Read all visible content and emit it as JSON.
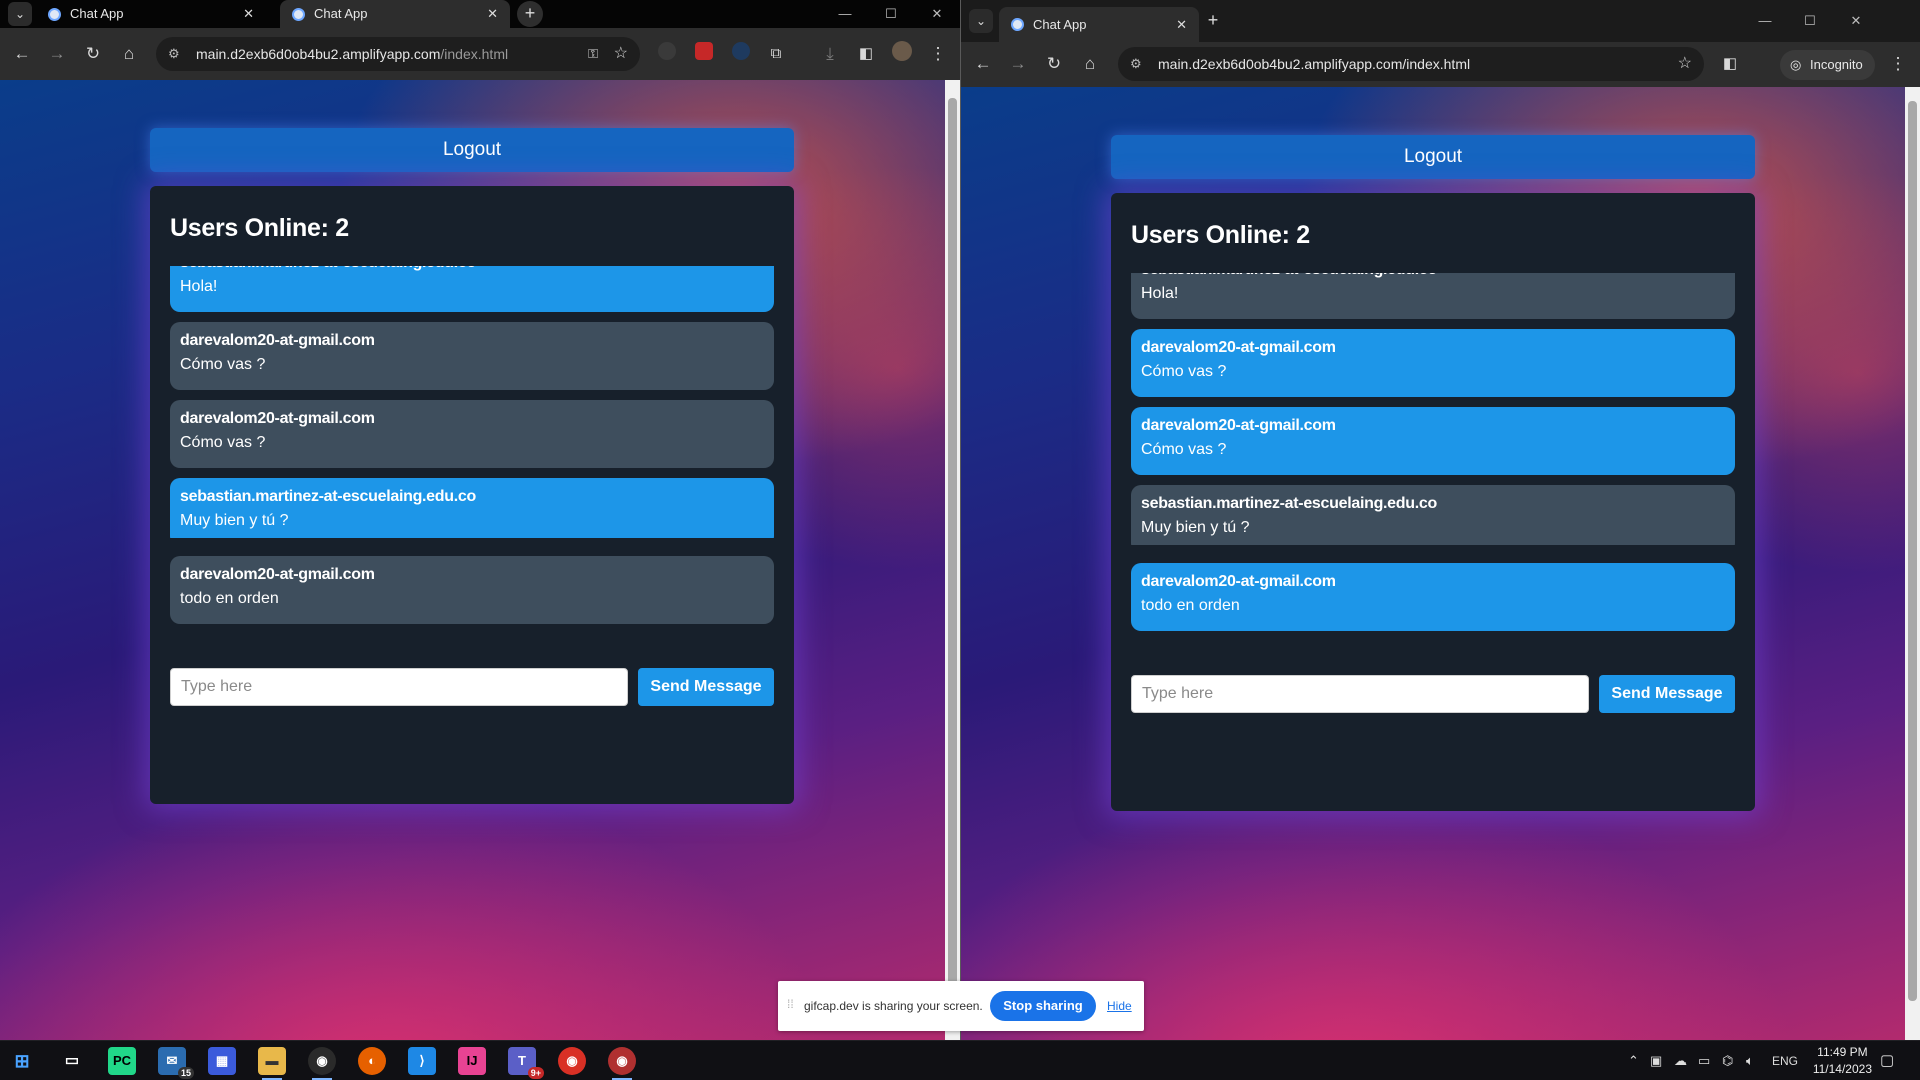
{
  "browser": {
    "tab_title": "Chat App",
    "url_host": "main.d2exb6d0ob4bu2.amplifyapp.com",
    "url_path": "/index.html",
    "incognito_label": "Incognito"
  },
  "app": {
    "logout_label": "Logout",
    "users_online": "Users Online: 2",
    "input_placeholder": "Type here",
    "send_label": "Send Message",
    "messages": [
      {
        "sender": "sebastian.martinez-at-escuelaing.edu.co",
        "text": "Hola!"
      },
      {
        "sender": "darevalom20-at-gmail.com",
        "text": "Cómo vas ?"
      },
      {
        "sender": "darevalom20-at-gmail.com",
        "text": "Cómo vas ?"
      },
      {
        "sender": "sebastian.martinez-at-escuelaing.edu.co",
        "text": "Muy bien y tú ?"
      },
      {
        "sender": "darevalom20-at-gmail.com",
        "text": "todo en orden"
      }
    ]
  },
  "share_banner": {
    "text": "gifcap.dev is sharing your screen.",
    "stop_label": "Stop sharing",
    "hide_label": "Hide"
  },
  "taskbar": {
    "mail_badge": "15",
    "teams_badge": "9+",
    "lang": "ENG",
    "time": "11:49 PM",
    "date": "11/14/2023"
  },
  "colors": {
    "mine_bubble": "#1d96e8",
    "other_bubble": "#3e4e5d",
    "card_bg": "#17202b",
    "logout_bg": "#1565c0"
  }
}
